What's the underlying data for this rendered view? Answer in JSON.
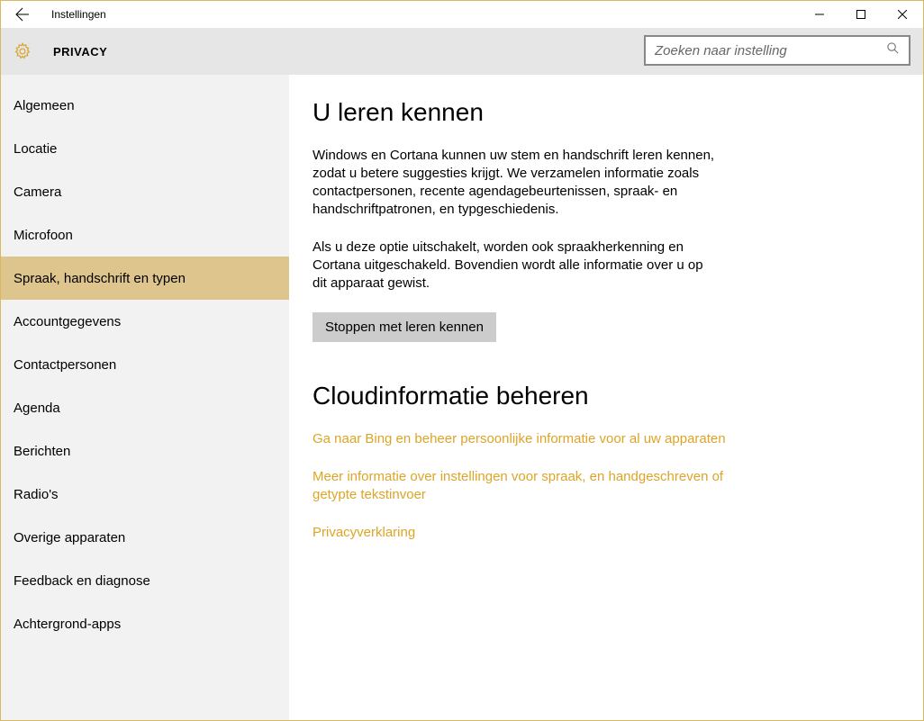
{
  "window": {
    "title": "Instellingen"
  },
  "header": {
    "category": "PRIVACY",
    "search_placeholder": "Zoeken naar instelling"
  },
  "sidebar": {
    "items": [
      {
        "label": "Algemeen",
        "selected": false
      },
      {
        "label": "Locatie",
        "selected": false
      },
      {
        "label": "Camera",
        "selected": false
      },
      {
        "label": "Microfoon",
        "selected": false
      },
      {
        "label": "Spraak, handschrift en typen",
        "selected": true
      },
      {
        "label": "Accountgegevens",
        "selected": false
      },
      {
        "label": "Contactpersonen",
        "selected": false
      },
      {
        "label": "Agenda",
        "selected": false
      },
      {
        "label": "Berichten",
        "selected": false
      },
      {
        "label": "Radio's",
        "selected": false
      },
      {
        "label": "Overige apparaten",
        "selected": false
      },
      {
        "label": "Feedback en diagnose",
        "selected": false
      },
      {
        "label": "Achtergrond-apps",
        "selected": false
      }
    ]
  },
  "main": {
    "section1_heading": "U leren kennen",
    "section1_para1": "Windows en Cortana kunnen uw stem en handschrift leren kennen, zodat u betere suggesties krijgt. We verzamelen informatie zoals contactpersonen, recente agendagebeurtenissen, spraak- en handschriftpatronen, en typgeschiedenis.",
    "section1_para2": "Als u deze optie uitschakelt, worden ook spraakherkenning en Cortana uitgeschakeld. Bovendien wordt alle informatie over u op dit apparaat gewist.",
    "stop_button": "Stoppen met leren kennen",
    "section2_heading": "Cloudinformatie beheren",
    "link1": "Ga naar Bing en beheer persoonlijke informatie voor al uw apparaten",
    "link2": "Meer informatie over instellingen voor spraak, en handgeschreven of getypte tekstinvoer",
    "link3": "Privacyverklaring"
  }
}
